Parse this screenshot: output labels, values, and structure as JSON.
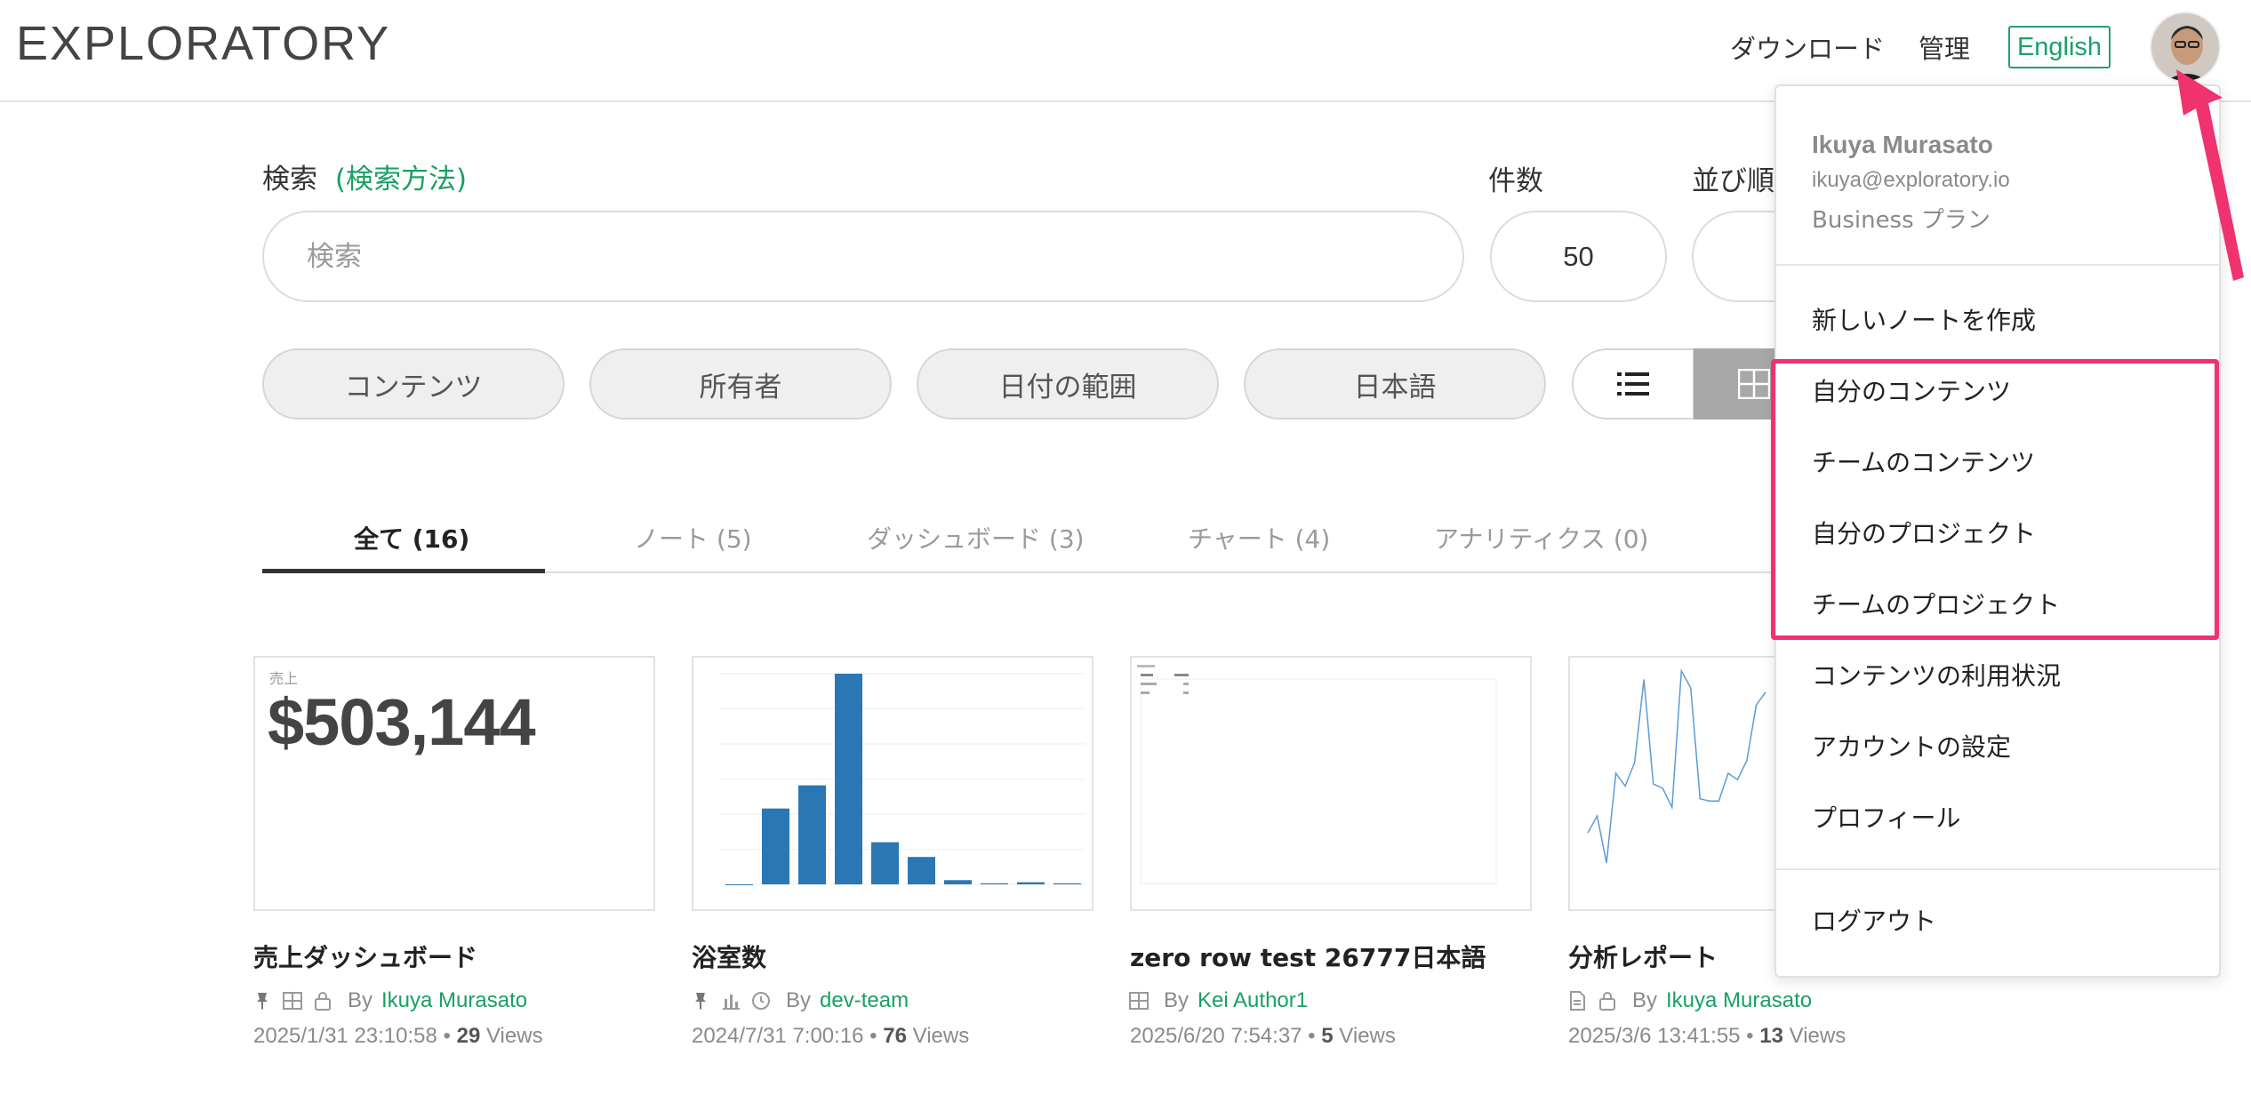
{
  "header": {
    "logo": "EXPLORATORY",
    "nav": {
      "download": "ダウンロード",
      "admin": "管理",
      "language": "English"
    }
  },
  "search": {
    "label": "検索",
    "help_link": "(検索方法)",
    "placeholder": "検索",
    "count_label": "件数",
    "count_value": "50",
    "sort_label": "並び順"
  },
  "filters": [
    "コンテンツ",
    "所有者",
    "日付の範囲",
    "日本語"
  ],
  "tabs": [
    {
      "label": "全て (16)",
      "active": true
    },
    {
      "label": "ノート (5)"
    },
    {
      "label": "ダッシュボード (3)"
    },
    {
      "label": "チャート (4)"
    },
    {
      "label": "アナリティクス (0)"
    }
  ],
  "cards": [
    {
      "title": "売上ダッシュボード",
      "thumb_label": "売上",
      "thumb_value": "$503,144",
      "by": "By",
      "author": "Ikuya Murasato",
      "date": "2025/1/31 23:10:58",
      "views_count": "29",
      "views_label": "Views",
      "icons": [
        "pin-icon",
        "dashboard-icon",
        "lock-icon"
      ]
    },
    {
      "title": "浴室数",
      "by": "By",
      "author": "dev-team",
      "date": "2024/7/31 7:00:16",
      "views_count": "76",
      "views_label": "Views",
      "icons": [
        "pin-icon",
        "bar-chart-icon",
        "clock-icon"
      ]
    },
    {
      "title": "zero row test 26777日本語",
      "by": "By",
      "author": "Kei Author1",
      "date": "2025/6/20 7:54:37",
      "views_count": "5",
      "views_label": "Views",
      "icons": [
        "dashboard-icon"
      ]
    },
    {
      "title": "分析レポート",
      "by": "By",
      "author": "Ikuya Murasato",
      "date": "2025/3/6 13:41:55",
      "views_count": "13",
      "views_label": "Views",
      "icons": [
        "document-icon",
        "lock-icon"
      ]
    }
  ],
  "thumb_chart_bars": [
    0,
    0.36,
    0.47,
    1.0,
    0.2,
    0.13,
    0.02,
    0.005,
    0.01,
    0.005
  ],
  "thumb_line_values": [
    0.22,
    0.3,
    0.08,
    0.5,
    0.44,
    0.55,
    0.94,
    0.45,
    0.43,
    0.34,
    0.98,
    0.9,
    0.38,
    0.37,
    0.37,
    0.5,
    0.47,
    0.56,
    0.82,
    0.88
  ],
  "dropdown": {
    "name": "Ikuya Murasato",
    "email": "ikuya@exploratory.io",
    "plan": "Business プラン",
    "items": [
      "新しいノートを作成",
      "自分のコンテンツ",
      "チームのコンテンツ",
      "自分のプロジェクト",
      "チームのプロジェクト",
      "コンテンツの利用状況",
      "アカウントの設定",
      "プロフィール",
      "ログアウト"
    ]
  },
  "colors": {
    "accent_green": "#19a064",
    "highlight_pink": "#f0326f",
    "bar_blue": "#2a77b4"
  }
}
